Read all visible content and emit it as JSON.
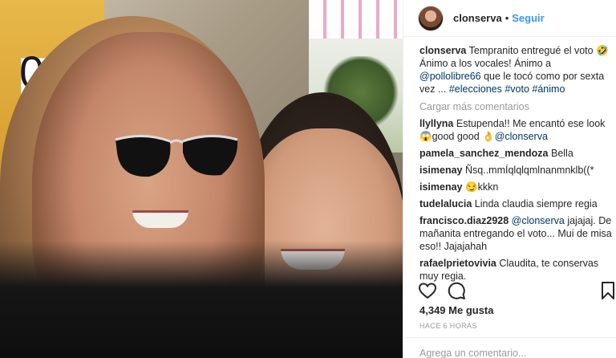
{
  "header": {
    "username": "clonserva",
    "separator": "•",
    "follow_label": "Seguir"
  },
  "photo": {
    "booth_number": "0"
  },
  "caption": {
    "username": "clonserva",
    "text_1": "Tempranito entregué el voto 🤣 Ánimo a los vocales! Ánimo a ",
    "mention": "@pollolibre66",
    "text_2": " que le tocó como por sexta vez ... ",
    "hashtags": [
      "#elecciones",
      "#voto",
      "#ánimo"
    ]
  },
  "load_more": "Cargar más comentarios",
  "comments": [
    {
      "user": "llyllyna",
      "text": "Estupenda!! Me encantó ese look 😱good good 👌",
      "mention": "@clonserva"
    },
    {
      "user": "pamela_sanchez_mendoza",
      "text": "Bella"
    },
    {
      "user": "isimenay",
      "text": "Ñsq..mmÍqlqlqmlnanmnklb((*"
    },
    {
      "user": "isimenay",
      "text": "😏kkkn"
    },
    {
      "user": "tudelalucia",
      "text": "Linda claudia siempre regia"
    },
    {
      "user": "francisco.diaz2928",
      "mention": "@clonserva",
      "text": " jajajaj. De mañanita entregando el voto... Mui de misa eso!! Jajajahah"
    },
    {
      "user": "rafaelprietovivia",
      "text": "Claudita, te conservas muy regia."
    }
  ],
  "actions": {
    "like_icon": "heart-icon",
    "comment_icon": "comment-bubble-icon",
    "save_icon": "bookmark-icon"
  },
  "likes": "4,349 Me gusta",
  "time": "HACE 6 HORAS",
  "add_comment": {
    "placeholder": "Agrega un comentario..."
  }
}
